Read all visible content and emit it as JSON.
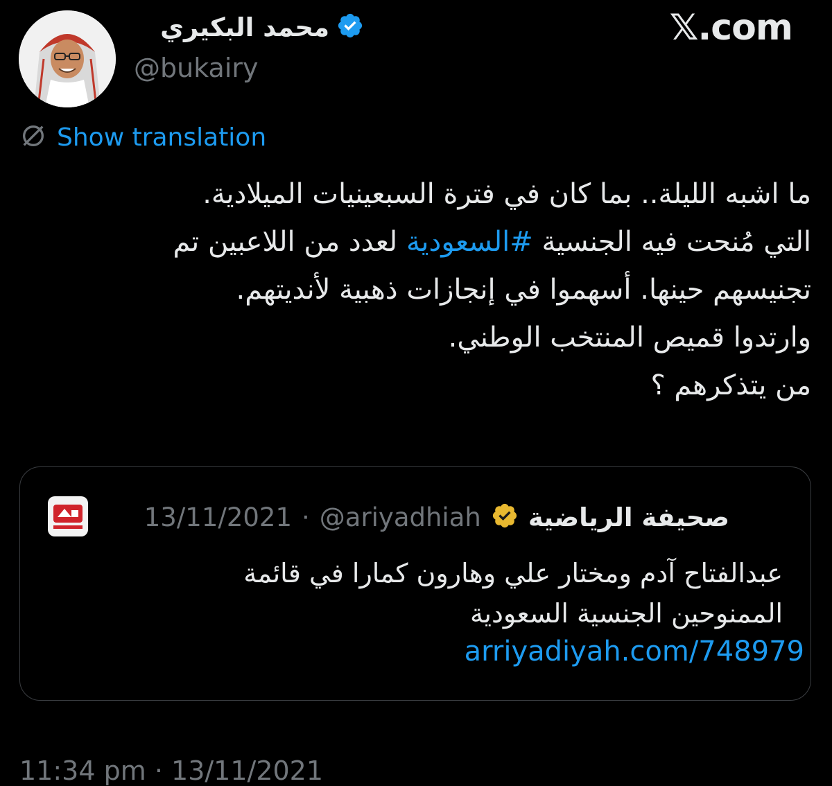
{
  "author": {
    "name": "محمد البكيري",
    "handle": "@bukairy",
    "verified": true
  },
  "site_label": "𝕏.com",
  "translate": {
    "label": "Show translation",
    "icon": "globe-icon"
  },
  "tweet": {
    "line1": "ما اشبه الليلة.. بما كان في فترة السبعينيات الميلادية.",
    "line2_before": "التي مُنحت فيه الجنسية ",
    "line2_hashtag": "#السعودية",
    "line2_after": " لعدد من اللاعبين تم",
    "line3": "تجنيسهم حينها. أسهموا في إنجازات ذهبية لأنديتهم.",
    "line4": "وارتدوا قميص المنتخب الوطني.",
    "line5": "من يتذكرهم ؟"
  },
  "quoted": {
    "name": "صحيفة الرياضية",
    "handle": "@ariyadhiah",
    "separator": "·",
    "date": "13/11/2021",
    "verified_badge": "gold-check-badge",
    "line1": "عبدالفتاح آدم ومختار علي وهارون كمارا في قائمة",
    "line2": "الممنوحين الجنسية السعودية",
    "link": "arriyadiyah.com/748979"
  },
  "footer": {
    "time": "11:34 pm",
    "separator": "·",
    "date": "13/11/2021"
  },
  "colors": {
    "background": "#000000",
    "text": "#e7e9ea",
    "muted": "#71767b",
    "link": "#1d9bf0",
    "gold": "#e8b830"
  }
}
